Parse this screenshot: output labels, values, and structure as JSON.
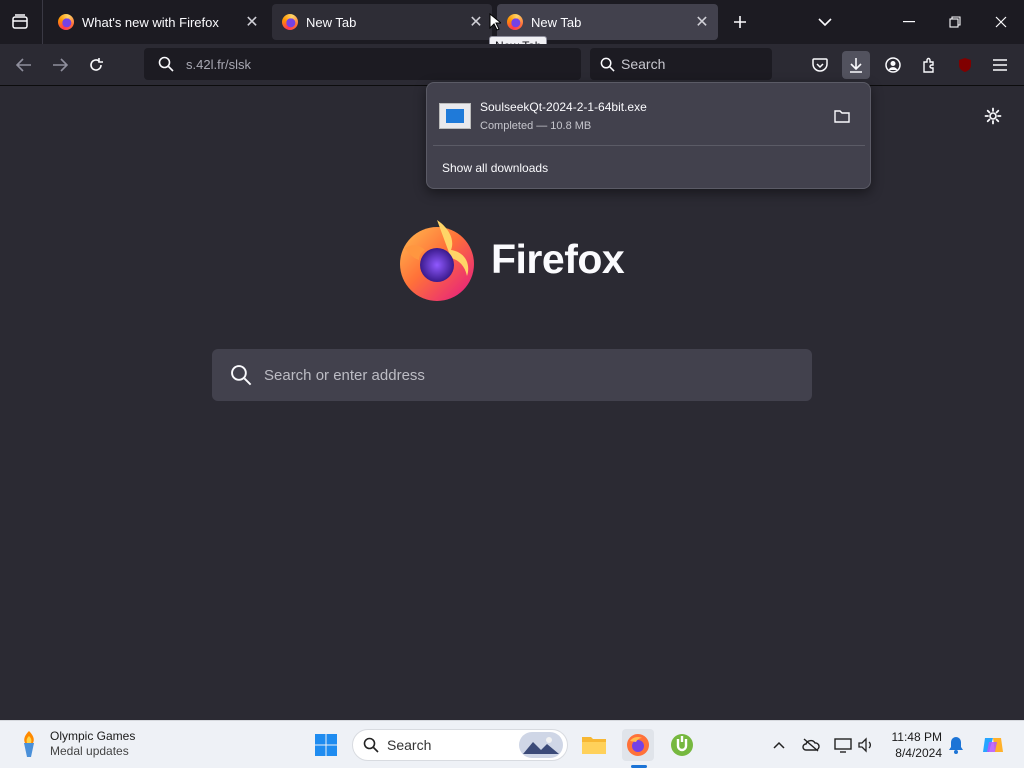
{
  "tabs": [
    {
      "title": "What's new with Firefox"
    },
    {
      "title": "New Tab"
    },
    {
      "title": "New Tab"
    }
  ],
  "tooltip": "New Tab",
  "urlbar": {
    "value": "s.42l.fr/slsk"
  },
  "searchbar": {
    "placeholder": "Search"
  },
  "downloads_panel": {
    "item": {
      "filename": "SoulseekQt-2024-2-1-64bit.exe",
      "status": "Completed — 10.8 MB"
    },
    "show_all": "Show all downloads"
  },
  "content": {
    "brand": "Firefox",
    "search_placeholder": "Search or enter address"
  },
  "taskbar": {
    "widget_title": "Olympic Games",
    "widget_subtitle": "Medal updates",
    "search_label": "Search",
    "time": "11:48 PM",
    "date": "8/4/2024"
  },
  "colors": {
    "background": "#2b2a33",
    "toolbar": "#1c1b22",
    "accent": "#1c74d6"
  }
}
